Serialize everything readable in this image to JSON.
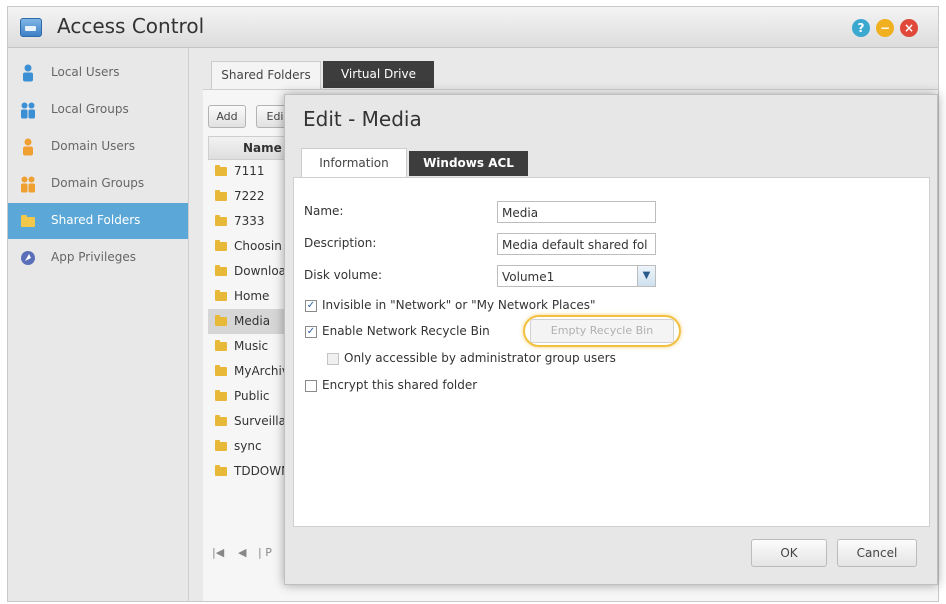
{
  "window": {
    "title": "Access Control",
    "controls": {
      "help": "?",
      "minimize": "−",
      "close": "×"
    }
  },
  "sidebar": {
    "items": [
      {
        "label": "Local Users",
        "icon": "user-icon",
        "color": "#3b8fd4"
      },
      {
        "label": "Local Groups",
        "icon": "group-icon",
        "color": "#3b8fd4"
      },
      {
        "label": "Domain Users",
        "icon": "domain-user-icon",
        "color": "#f0a030"
      },
      {
        "label": "Domain Groups",
        "icon": "domain-group-icon",
        "color": "#f0a030"
      },
      {
        "label": "Shared Folders",
        "icon": "folder-icon",
        "color": "#f2c84a",
        "active": true
      },
      {
        "label": "App Privileges",
        "icon": "app-privileges-icon",
        "color": "#5a6fb8"
      }
    ]
  },
  "tabs": {
    "shared_folders": "Shared Folders",
    "virtual_drive": "Virtual Drive"
  },
  "toolbar": {
    "add": "Add",
    "edit": "Edi"
  },
  "folder_list": {
    "header": "Name",
    "rows": [
      "7111",
      "7222",
      "7333",
      "Choosin",
      "Downloa",
      "Home",
      "Media",
      "Music",
      "MyArchiv",
      "Public",
      "Surveillar",
      "sync",
      "TDDOWN"
    ],
    "selected": "Media",
    "pager": {
      "first": "|◀",
      "prev": "◀",
      "page_label": "| P"
    }
  },
  "dialog": {
    "title": "Edit - Media",
    "tabs": {
      "information": "Information",
      "windows_acl": "Windows ACL"
    },
    "fields": {
      "name_label": "Name:",
      "name_value": "Media",
      "description_label": "Description:",
      "description_value": "Media default shared fol",
      "disk_volume_label": "Disk volume:",
      "disk_volume_value": "Volume1"
    },
    "options": {
      "invisible": {
        "label": "Invisible in \"Network\" or \"My Network Places\"",
        "checked": true
      },
      "recycle_bin": {
        "label": "Enable Network Recycle Bin",
        "checked": true
      },
      "admin_only": {
        "label": "Only accessible by administrator group users",
        "checked": false
      },
      "encrypt": {
        "label": "Encrypt this shared folder",
        "checked": false
      }
    },
    "empty_recycle_bin": "Empty Recycle Bin",
    "ok": "OK",
    "cancel": "Cancel"
  },
  "colors": {
    "accent": "#5ba8d8",
    "highlight": "#f2c040",
    "dark_tab": "#3d3d3d"
  }
}
